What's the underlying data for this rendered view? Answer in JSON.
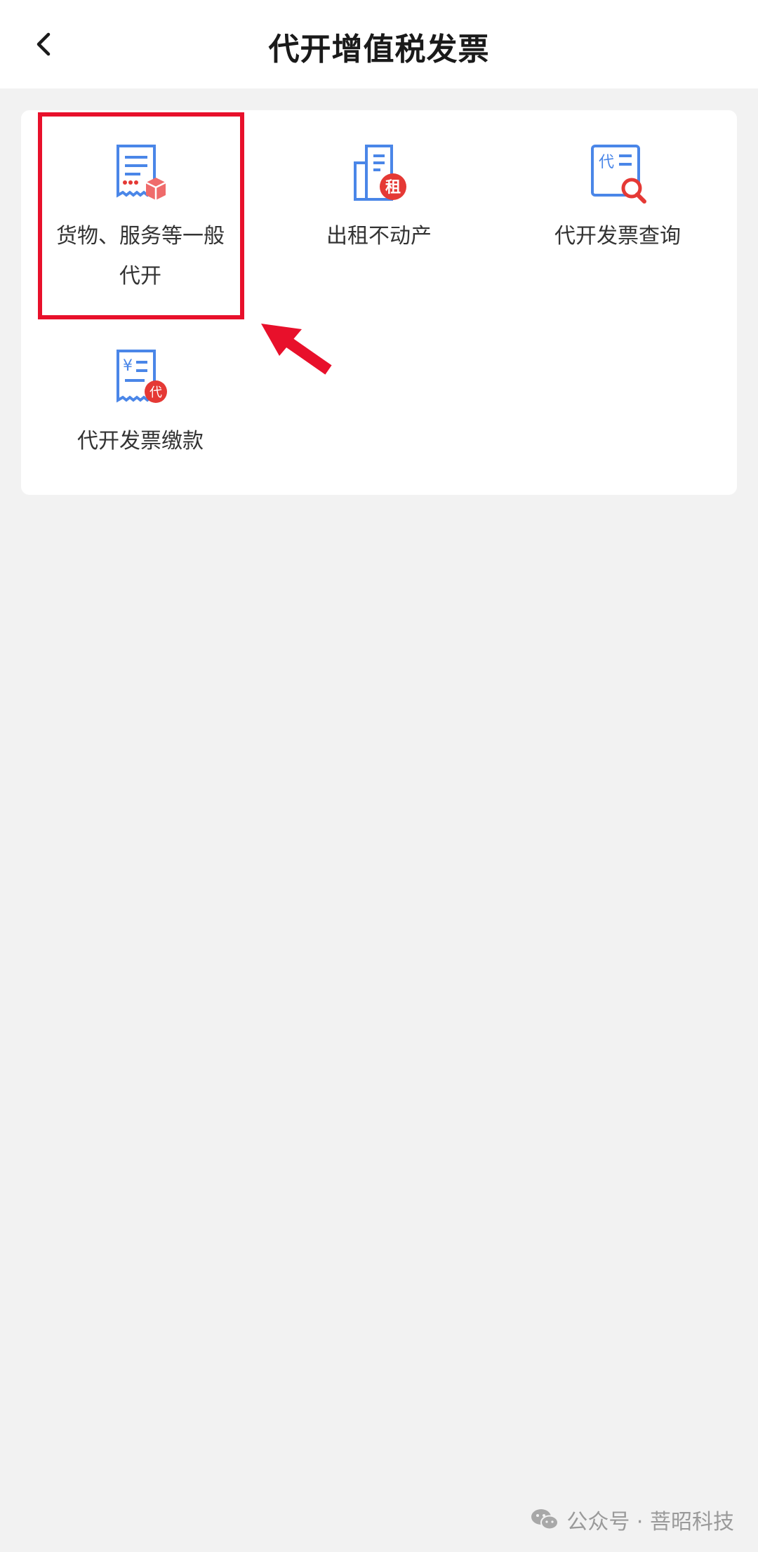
{
  "header": {
    "title": "代开增值税发票",
    "back_icon": "chevron-left-icon"
  },
  "tiles": [
    {
      "label": "货物、服务等一般代开",
      "icon": "receipt-box-icon"
    },
    {
      "label": "出租不动产",
      "icon": "building-rent-icon"
    },
    {
      "label": "代开发票查询",
      "icon": "invoice-search-icon"
    },
    {
      "label": "代开发票缴款",
      "icon": "invoice-payment-icon"
    }
  ],
  "annotations": {
    "highlight_color": "#e8102b",
    "arrow_color": "#e8102b"
  },
  "colors": {
    "icon_blue": "#4a86e8",
    "badge_red": "#e53935"
  },
  "watermark": {
    "text": "公众号 · 菩昭科技",
    "icon": "wechat-icon"
  }
}
